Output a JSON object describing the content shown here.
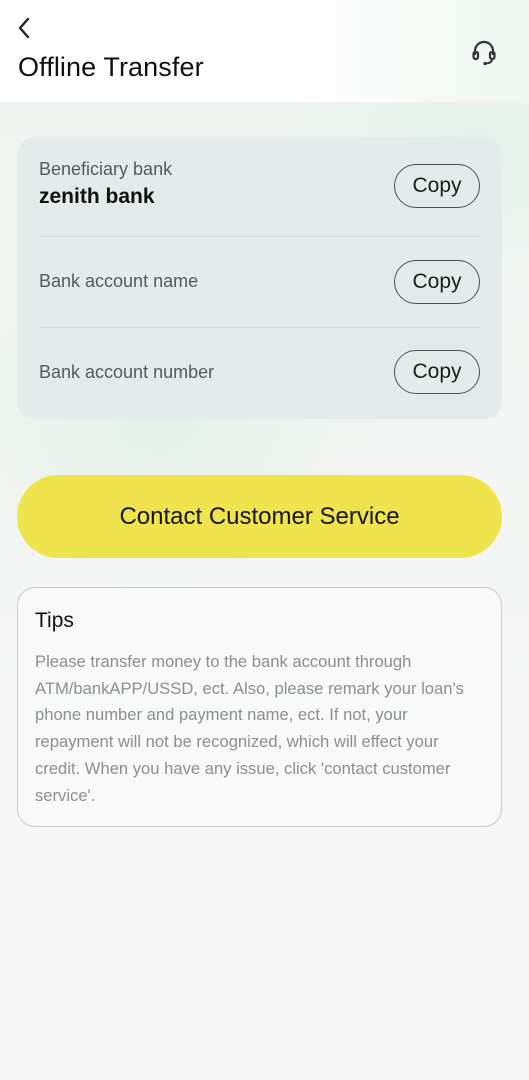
{
  "header": {
    "back_icon": "chevron-left-icon",
    "title": "Offline Transfer",
    "support_icon": "headset-icon"
  },
  "bank_info": {
    "rows": [
      {
        "label": "Beneficiary bank",
        "value": "zenith bank",
        "copy_label": "Copy"
      },
      {
        "label": "Bank account name",
        "value": "",
        "copy_label": "Copy"
      },
      {
        "label": "Bank account number",
        "value": "",
        "copy_label": "Copy"
      }
    ]
  },
  "contact_button": {
    "label": "Contact Customer Service"
  },
  "tips": {
    "title": "Tips",
    "body": "Please transfer money to the bank account through ATM/bankAPP/USSD, ect. Also, please remark your loan's phone number and payment name, ect. If not, your repayment will not be recognized, which will effect your credit. When you have any issue, click 'contact customer service'."
  },
  "colors": {
    "accent_yellow": "#f0e44e",
    "card_background": "#e3ebeb",
    "tips_text": "#8c8f8f"
  }
}
